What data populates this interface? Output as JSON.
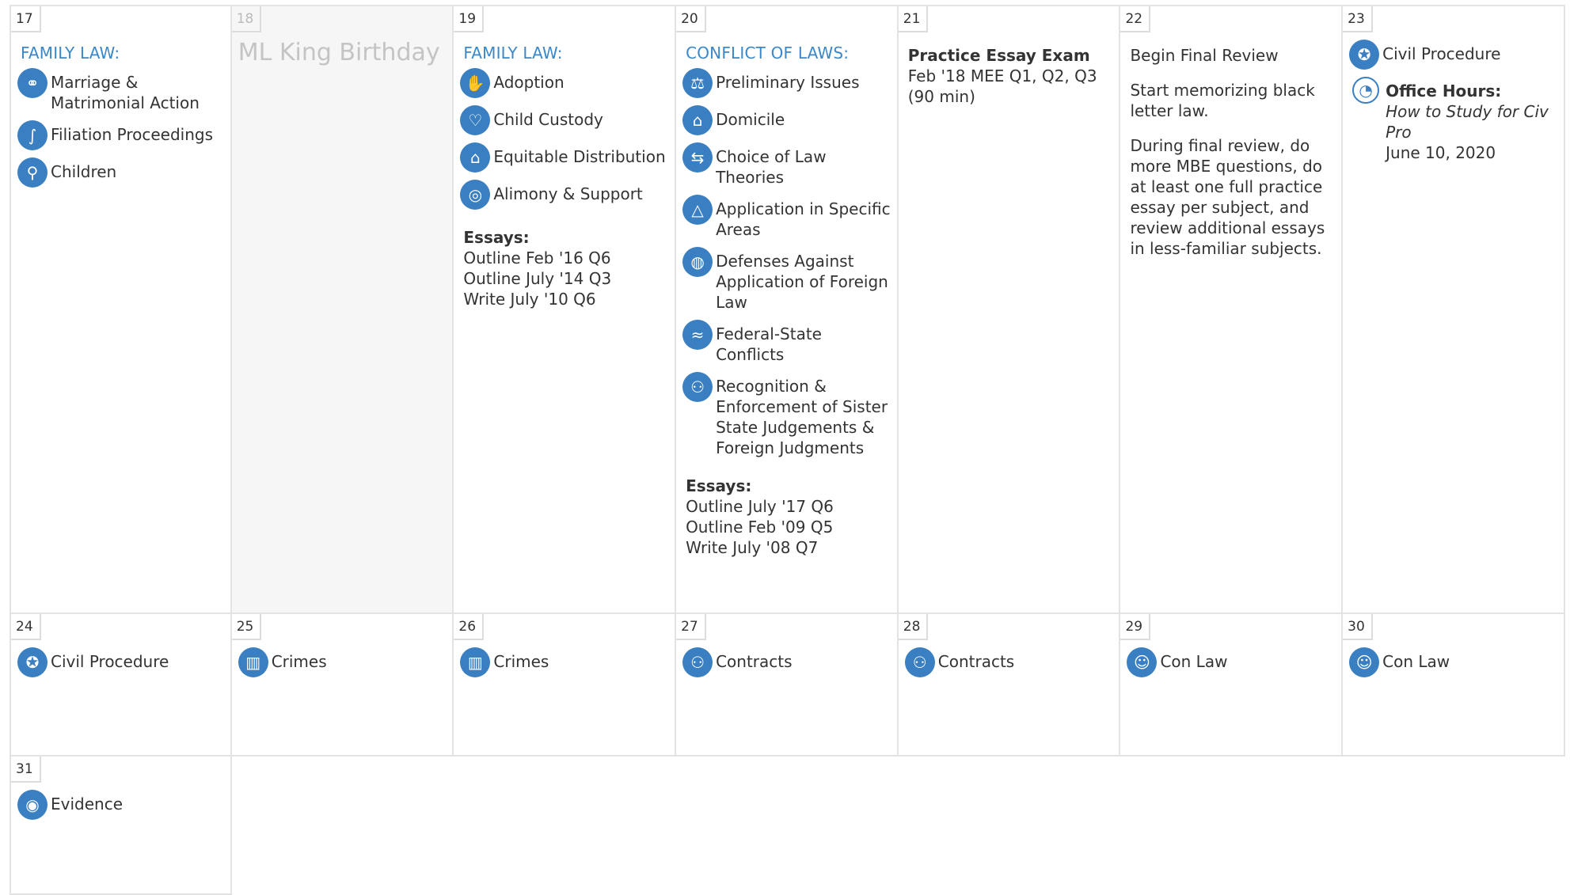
{
  "icons": {
    "accent": "#3a7fc1",
    "subject_color": "#3b87c8"
  },
  "week1": {
    "d17": {
      "num": "17",
      "subject": "FAMILY LAW:",
      "items": [
        {
          "label": "Marriage & Matrimonial Action",
          "icon": "wedding-couple-icon"
        },
        {
          "label": "Filiation Proceedings",
          "icon": "umbilical-cord-icon"
        },
        {
          "label": "Children",
          "icon": "parent-child-icon"
        }
      ]
    },
    "d18": {
      "num": "18",
      "holiday": "ML King Birthday"
    },
    "d19": {
      "num": "19",
      "subject": "FAMILY LAW:",
      "items": [
        {
          "label": "Adoption",
          "icon": "hand-icon"
        },
        {
          "label": "Child Custody",
          "icon": "family-hold-icon"
        },
        {
          "label": "Equitable Distribution",
          "icon": "house-icon"
        },
        {
          "label": "Alimony & Support",
          "icon": "lifebuoy-icon"
        }
      ],
      "essays_heading": "Essays:",
      "essays": [
        "Outline Feb '16 Q6",
        "Outline July '14 Q3",
        "Write July '10 Q6"
      ]
    },
    "d20": {
      "num": "20",
      "subject": "CONFLICT OF LAWS:",
      "items": [
        {
          "label": "Preliminary Issues",
          "icon": "courthouse-icon"
        },
        {
          "label": "Domicile",
          "icon": "home-icon"
        },
        {
          "label": "Choice of Law Theories",
          "icon": "signpost-icon"
        },
        {
          "label": "Application in Specific Areas",
          "icon": "triangle-icon"
        },
        {
          "label": "Defenses Against Application of Foreign Law",
          "icon": "globe-icon"
        },
        {
          "label": "Federal-State Conflicts",
          "icon": "wave-icon"
        },
        {
          "label": "Recognition & Enforcement of Sister State Judgements & Foreign Judgments",
          "icon": "people-icon"
        }
      ],
      "essays_heading": "Essays:",
      "essays": [
        "Outline July '17 Q6",
        "Outline Feb '09 Q5",
        "Write July '08 Q7"
      ]
    },
    "d21": {
      "num": "21",
      "title": "Practice Essay Exam",
      "lines": [
        "Feb '18 MEE Q1, Q2, Q3",
        "(90 min)"
      ]
    },
    "d22": {
      "num": "22",
      "paras": [
        "Begin Final Review",
        "Start memorizing black letter law.",
        "During final review, do more MBE questions, do at least one full practice essay per subject, and review additional essays in less-familiar subjects."
      ]
    },
    "d23": {
      "num": "23",
      "item": {
        "label": "Civil Procedure",
        "icon": "eagle-seal-icon"
      },
      "office_hours": {
        "title": "Office Hours:",
        "topic": "How to Study for Civ Pro",
        "date": "June 10, 2020",
        "icon": "clock-icon"
      }
    }
  },
  "week2": [
    {
      "num": "24",
      "label": "Civil Procedure",
      "icon": "eagle-seal-icon"
    },
    {
      "num": "25",
      "label": "Crimes",
      "icon": "jail-bars-icon"
    },
    {
      "num": "26",
      "label": "Crimes",
      "icon": "jail-bars-icon"
    },
    {
      "num": "27",
      "label": "Contracts",
      "icon": "handshake-people-icon"
    },
    {
      "num": "28",
      "label": "Contracts",
      "icon": "handshake-people-icon"
    },
    {
      "num": "29",
      "label": "Con Law",
      "icon": "mask-icon"
    },
    {
      "num": "30",
      "label": "Con Law",
      "icon": "mask-icon"
    }
  ],
  "week3": [
    {
      "num": "31",
      "label": "Evidence",
      "icon": "fingerprint-icon"
    }
  ]
}
